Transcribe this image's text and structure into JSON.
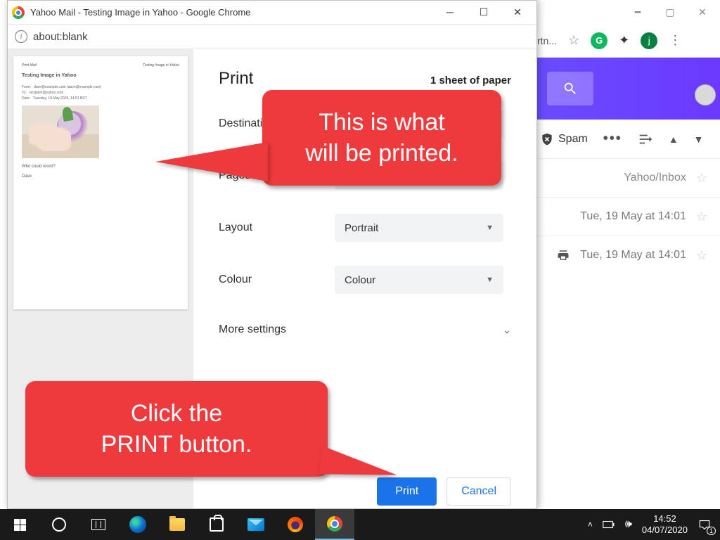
{
  "bg_browser": {
    "toolbar_trunc": "rtn...",
    "avatar_letter": "j"
  },
  "yahoo": {
    "spam_label": "Spam",
    "rows": [
      {
        "label": "Yahoo/Inbox"
      },
      {
        "label": "Tue, 19 May at 14:01"
      },
      {
        "label": "Tue, 19 May at 14:01",
        "has_print": true
      }
    ]
  },
  "print_window": {
    "title": "Yahoo Mail - Testing Image in Yahoo - Google Chrome",
    "url": "about:blank",
    "heading": "Print",
    "sheet_info": "1 sheet of paper",
    "labels": {
      "destination": "Destination",
      "pages": "Pages",
      "layout": "Layout",
      "colour": "Colour",
      "more": "More settings"
    },
    "values": {
      "layout": "Portrait",
      "colour": "Colour"
    },
    "buttons": {
      "print": "Print",
      "cancel": "Cancel"
    },
    "preview": {
      "subject": "Testing Image in Yahoo",
      "line_who": "Who could resist?",
      "line_sig": "Dave"
    }
  },
  "callouts": {
    "c1_l1": "This is what",
    "c1_l2": "will be printed.",
    "c2_l1": "Click the",
    "c2_l2": "PRINT button."
  },
  "taskbar": {
    "time": "14:52",
    "date": "04/07/2020",
    "notif_count": "1"
  }
}
